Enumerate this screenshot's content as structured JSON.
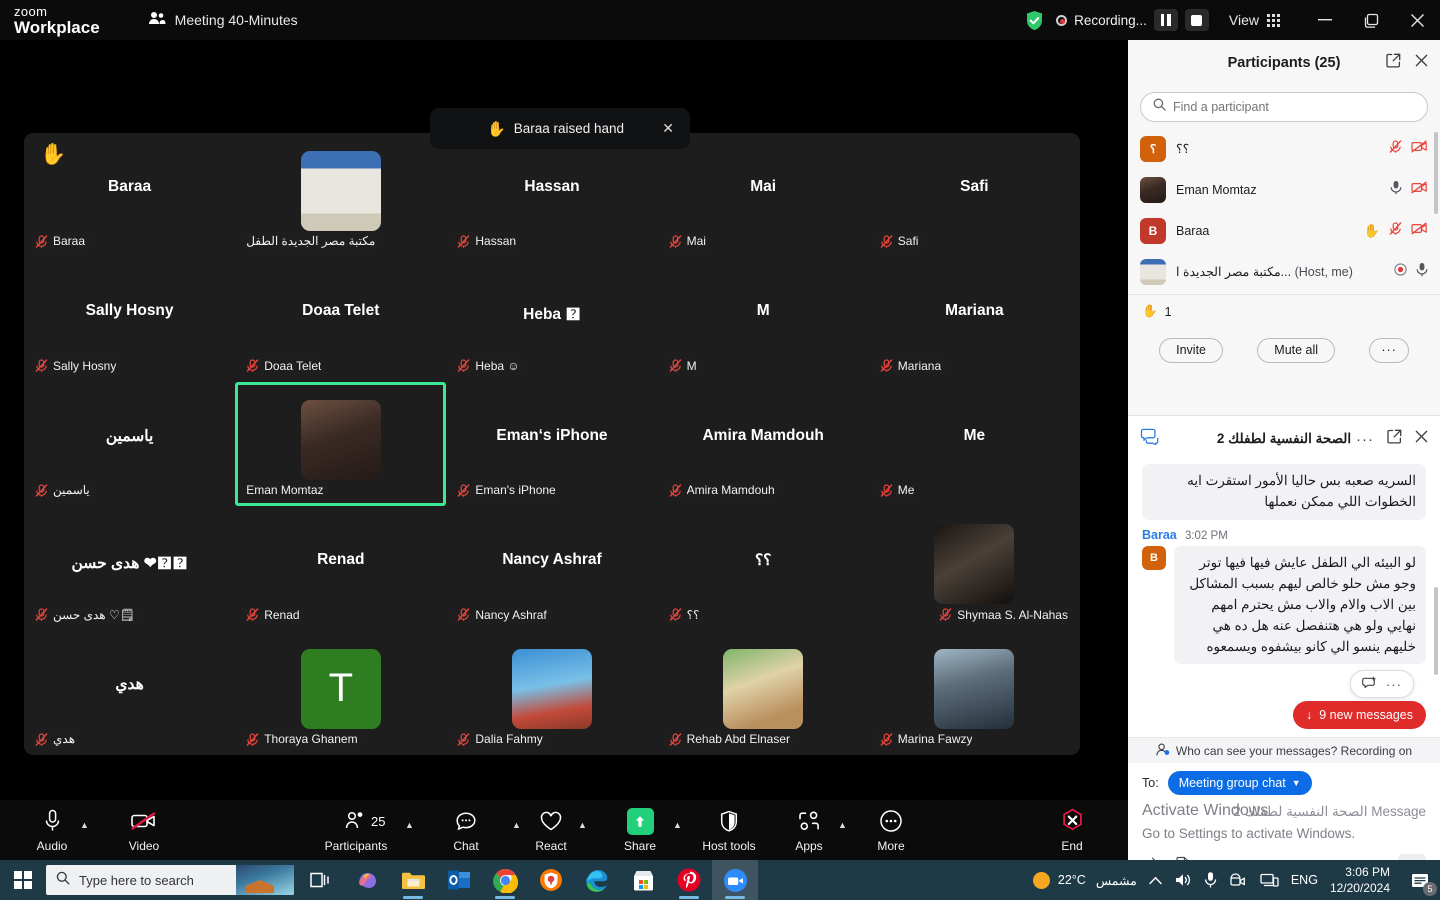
{
  "titlebar": {
    "brand_line1": "zoom",
    "brand_line2": "Workplace",
    "meeting_title": "Meeting 40-Minutes",
    "recording_label": "Recording...",
    "view_label": "View",
    "icons": {
      "participants": "participants-icon",
      "shield": "security-shield-icon",
      "pause": "pause-recording-icon",
      "stop": "stop-recording-icon",
      "view_grid": "grid-view-icon",
      "minimize": "minimize-icon",
      "maximize": "maximize-icon",
      "close": "close-icon"
    }
  },
  "toast": {
    "hand": "✋",
    "text": "Baraa raised hand",
    "close": "✕"
  },
  "stage": {
    "hand_flag": "✋",
    "tiles": [
      {
        "big": "Baraa",
        "name": "Baraa",
        "muted": true,
        "avatar": null,
        "align": "left",
        "active": false
      },
      {
        "big": "",
        "name": "مكتبة مصر الجديدة الطفل",
        "muted": false,
        "avatar": "library",
        "align": "left",
        "active": false
      },
      {
        "big": "Hassan",
        "name": "Hassan",
        "muted": true,
        "avatar": null,
        "align": "left",
        "active": false
      },
      {
        "big": "Mai",
        "name": "Mai",
        "muted": true,
        "avatar": null,
        "align": "left",
        "active": false
      },
      {
        "big": "Safi",
        "name": "Safi",
        "muted": true,
        "avatar": null,
        "align": "left",
        "active": false
      },
      {
        "big": "Sally Hosny",
        "name": "Sally Hosny",
        "muted": true,
        "avatar": null,
        "align": "left",
        "active": false
      },
      {
        "big": "Doaa Telet",
        "name": "Doaa Telet",
        "muted": true,
        "avatar": null,
        "align": "left",
        "active": false
      },
      {
        "big": "Heba 🯄",
        "name": "Heba ☺",
        "muted": true,
        "avatar": null,
        "align": "left",
        "active": false
      },
      {
        "big": "M",
        "name": "M",
        "muted": true,
        "avatar": null,
        "align": "left",
        "active": false
      },
      {
        "big": "Mariana",
        "name": "Mariana",
        "muted": true,
        "avatar": null,
        "align": "left",
        "active": false
      },
      {
        "big": "ياسمين",
        "name": "ياسمين",
        "muted": true,
        "avatar": null,
        "align": "left",
        "active": false
      },
      {
        "big": "",
        "name": "Eman Momtaz",
        "muted": false,
        "avatar": "eman",
        "align": "left",
        "active": true
      },
      {
        "big": "Eman‘s iPhone",
        "name": "Eman's iPhone",
        "muted": true,
        "avatar": null,
        "align": "left",
        "active": false
      },
      {
        "big": "Amira Mamdouh",
        "name": "Amira Mamdouh",
        "muted": true,
        "avatar": null,
        "align": "left",
        "active": false
      },
      {
        "big": "Me",
        "name": "Me",
        "muted": true,
        "avatar": null,
        "align": "left",
        "active": false
      },
      {
        "big": "هدى حسن ❤🯄🯄",
        "name": "هدى حسن ♡🗒",
        "muted": true,
        "avatar": null,
        "align": "left",
        "active": false
      },
      {
        "big": "Renad",
        "name": "Renad",
        "muted": true,
        "avatar": null,
        "align": "left",
        "active": false
      },
      {
        "big": "Nancy Ashraf",
        "name": "Nancy Ashraf",
        "muted": true,
        "avatar": null,
        "align": "left",
        "active": false
      },
      {
        "big": "؟؟",
        "name": "؟؟",
        "muted": true,
        "avatar": null,
        "align": "left",
        "active": false
      },
      {
        "big": "",
        "name": "Shymaa S. Al-Nahas",
        "muted": true,
        "avatar": "bride",
        "align": "right",
        "active": false
      },
      {
        "big": "هدي",
        "name": "هدي",
        "muted": true,
        "avatar": null,
        "align": "left",
        "active": false
      },
      {
        "big": "",
        "name": "Thoraya Ghanem",
        "muted": true,
        "avatar": "letterT",
        "align": "left",
        "active": false
      },
      {
        "big": "",
        "name": "Dalia Fahmy",
        "muted": true,
        "avatar": "horse",
        "align": "left",
        "active": false
      },
      {
        "big": "",
        "name": "Rehab Abd Elnaser",
        "muted": true,
        "avatar": "carl",
        "align": "left",
        "active": false
      },
      {
        "big": "",
        "name": "Marina Fawzy",
        "muted": true,
        "avatar": "man",
        "align": "left",
        "active": false
      }
    ]
  },
  "toolbar": {
    "audio": "Audio",
    "video": "Video",
    "participants": "Participants",
    "participants_count": "25",
    "chat": "Chat",
    "react": "React",
    "share": "Share",
    "host_tools": "Host tools",
    "apps": "Apps",
    "more": "More",
    "end": "End"
  },
  "participants_panel": {
    "title": "Participants (25)",
    "search_placeholder": "Find a participant",
    "search_value": "",
    "rows": [
      {
        "name": "مكتبة مصر الجديدة ا...",
        "suffix": "(Host, me)",
        "initial": "",
        "color": "#cfd4da",
        "avatar": "library",
        "rec": true,
        "mic": "on",
        "video": null
      },
      {
        "name": "Baraa",
        "suffix": "",
        "initial": "B",
        "color": "#c0392b",
        "avatar": null,
        "rec": false,
        "mic": "muted",
        "video": "off",
        "hand": true
      },
      {
        "name": "Eman Momtaz",
        "suffix": "",
        "initial": "E",
        "color": "#7a3b2e",
        "avatar": "eman",
        "rec": false,
        "mic": "on",
        "video": "off"
      },
      {
        "name": "؟؟",
        "suffix": "",
        "initial": "؟",
        "color": "#d2610b",
        "avatar": null,
        "rec": false,
        "mic": "muted",
        "video": "off"
      }
    ],
    "hand_count": "1",
    "invite": "Invite",
    "mute_all": "Mute all",
    "more": "···"
  },
  "chat_panel": {
    "title": "الصحة النفسية لطفلك 2",
    "messages": [
      {
        "author": "",
        "time": "",
        "text": "السريه صعبه بس حاليا الأمور استقرت ايه الخطوات اللي ممكن نعملها",
        "initial": "",
        "color": ""
      },
      {
        "author": "Baraa",
        "time": "3:02 PM",
        "text": "لو البيئه الي الطفل عايش فيها فيها توتر وجو مش حلو خالص ليهم بسبب المشاكل بين الاب والام والاب مش يحترم امهم نهايي ولو هي هتنفصل عنه هل ده هي خليهم ينسو الي كانو بيشفوه ويسمعوه",
        "initial": "B",
        "color": "#d2610b"
      }
    ],
    "new_messages": "9 new messages",
    "privacy_note": "Who can see your messages? Recording on",
    "to_label": "To:",
    "to_value": "Meeting group chat",
    "message_placeholder": "Message الصحة النفسية لطفلك 2",
    "watermark_line1": "Activate Windows",
    "watermark_line2": "Go to Settings to activate Windows."
  },
  "taskbar": {
    "search_placeholder": "Type here to search",
    "icons": [
      "task-view-icon",
      "copilot-icon",
      "file-explorer-icon",
      "outlook-icon",
      "chrome-icon",
      "avast-icon",
      "edge-icon",
      "microsoft-store-icon",
      "pinterest-icon",
      "zoom-icon"
    ],
    "weather_temp": "22°C",
    "weather_desc": "مشمس",
    "language": "ENG",
    "time": "3:06 PM",
    "date": "12/20/2024",
    "notification_count": "5"
  },
  "colors": {
    "accent_blue": "#0b6ce5",
    "active_green": "#3ce894",
    "mute_red": "#e8453c",
    "record_red": "#e02b2b",
    "share_green": "#22d07a"
  }
}
